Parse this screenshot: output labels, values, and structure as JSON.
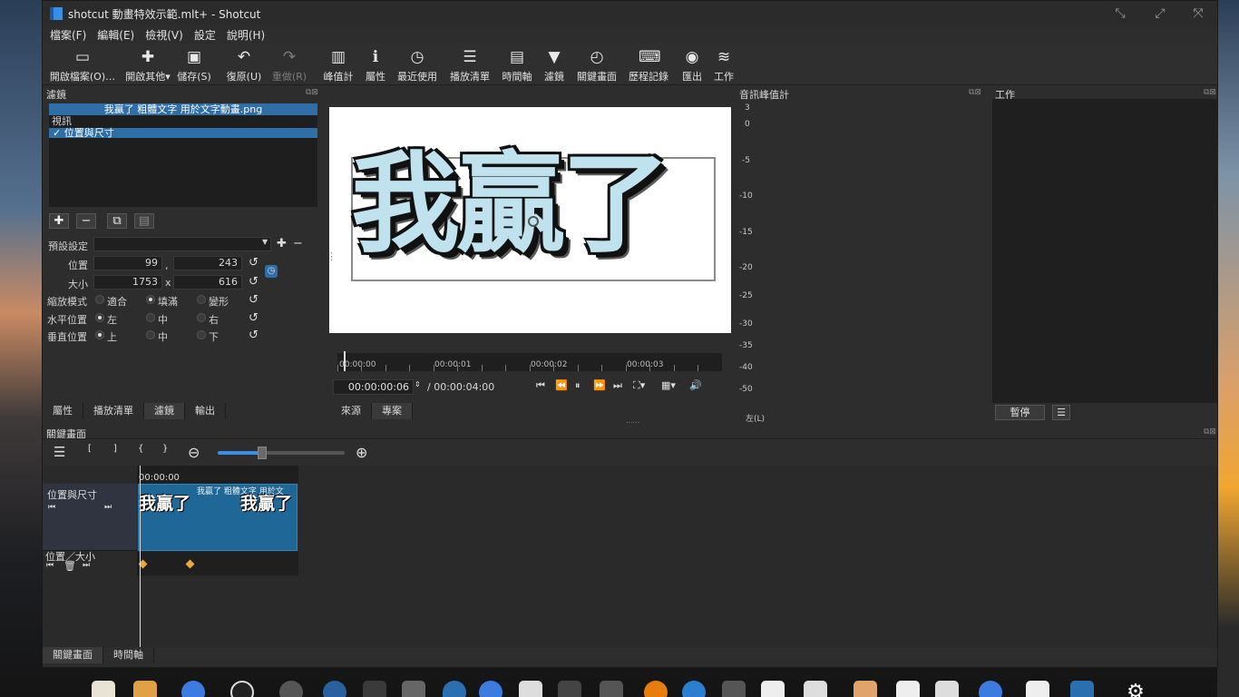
{
  "window": {
    "title": "shotcut 動畫特效示範.mlt+ - Shotcut",
    "controls": [
      "minimize",
      "maximize",
      "close"
    ]
  },
  "menu": [
    "檔案(F)",
    "編輯(E)",
    "檢視(V)",
    "設定",
    "說明(H)"
  ],
  "toolbar": [
    {
      "label": "開啟檔案(O)…",
      "icon": "open-folder-icon",
      "glyph": "▭"
    },
    {
      "label": "開啟其他▾",
      "icon": "open-other-icon",
      "glyph": "✚"
    },
    {
      "label": "儲存(S)",
      "icon": "save-icon",
      "glyph": "▣"
    },
    {
      "label": "復原(U)",
      "icon": "undo-icon",
      "glyph": "↶"
    },
    {
      "label": "重做(R)",
      "icon": "redo-icon",
      "glyph": "↷"
    },
    {
      "label": "峰值計",
      "icon": "peak-meter-icon",
      "glyph": "▥"
    },
    {
      "label": "屬性",
      "icon": "properties-icon",
      "glyph": "ℹ"
    },
    {
      "label": "最近使用",
      "icon": "recent-icon",
      "glyph": "◷"
    },
    {
      "label": "播放清單",
      "icon": "playlist-icon",
      "glyph": "☰"
    },
    {
      "label": "時間軸",
      "icon": "timeline-icon",
      "glyph": "▤"
    },
    {
      "label": "濾鏡",
      "icon": "filter-icon",
      "glyph": "▼"
    },
    {
      "label": "關鍵畫面",
      "icon": "keyframes-icon",
      "glyph": "◴"
    },
    {
      "label": "歷程記錄",
      "icon": "history-icon",
      "glyph": "⌨"
    },
    {
      "label": "匯出",
      "icon": "export-icon",
      "glyph": "◉"
    },
    {
      "label": "工作",
      "icon": "jobs-icon",
      "glyph": "≋"
    }
  ],
  "filters_panel": {
    "title": "濾鏡",
    "clip_name": "我贏了 粗體文字 用於文字動畫.png",
    "category": "視訊",
    "filter_item": "✓ 位置與尺寸",
    "preset_label": "預設設定",
    "preset_value": "",
    "position_label": "位置",
    "position_x": "99",
    "position_sep": ",",
    "position_y": "243",
    "size_label": "大小",
    "size_w": "1753",
    "size_sep": "x",
    "size_h": "616",
    "size_mode_label": "縮放模式",
    "size_modes": [
      "適合",
      "填滿",
      "變形"
    ],
    "size_mode_selected": "填滿",
    "h_align_label": "水平位置",
    "h_align": [
      "左",
      "中",
      "右"
    ],
    "h_align_selected": "左",
    "v_align_label": "垂直位置",
    "v_align": [
      "上",
      "中",
      "下"
    ],
    "v_align_selected": "上"
  },
  "left_tabs": [
    "屬性",
    "播放清單",
    "濾鏡",
    "輸出"
  ],
  "left_tab_active": "濾鏡",
  "player": {
    "preview_text": "我贏了",
    "ruler_labels": [
      "00:00:00",
      "00:00:01",
      "00:00:02",
      "00:00:03"
    ],
    "current_time": "00:00:00:06",
    "total_time": "/ 00:00:04:00",
    "tabs": [
      "來源",
      "專案"
    ],
    "tab_active": "專案"
  },
  "meter": {
    "title": "音訊峰值計",
    "scale": [
      "3",
      "0",
      "-5",
      "-10",
      "-15",
      "-20",
      "-25",
      "-30",
      "-35",
      "-40",
      "-50"
    ],
    "channel_label": "左(L)"
  },
  "jobs": {
    "title": "工作",
    "pause_label": "暫停",
    "menu_label": "☰"
  },
  "keyframes": {
    "title": "關鍵畫面",
    "toolbar_glyphs": [
      "☰",
      "[",
      "]",
      "{",
      "}"
    ],
    "zoom_out_icon": "zoom-out-icon",
    "zoom_in_icon": "zoom-in-icon",
    "zoom_level": 0.35,
    "ruler_label": "00:00:00",
    "track_label": "位置與尺寸",
    "param_label": "位置／大小",
    "clip_name": "我贏了 粗體文字 用於文",
    "thumb_text_1": "我贏了",
    "thumb_text_2": "我贏了",
    "bottom_tabs": [
      "關鍵畫面",
      "時間軸"
    ],
    "bottom_tab_active": "關鍵畫面"
  },
  "taskbar_apps": [
    "notepad",
    "folder",
    "chrome",
    "obs",
    "chat",
    "steam",
    "app",
    "inkscape",
    "blender-drop",
    "chrome-dev",
    "app2",
    "cat",
    "film",
    "blender",
    "headphones",
    "hexagon",
    "piano",
    "calculator",
    "file",
    "document",
    "check",
    "chrome2",
    "vscode",
    "shotcut",
    "settings"
  ]
}
